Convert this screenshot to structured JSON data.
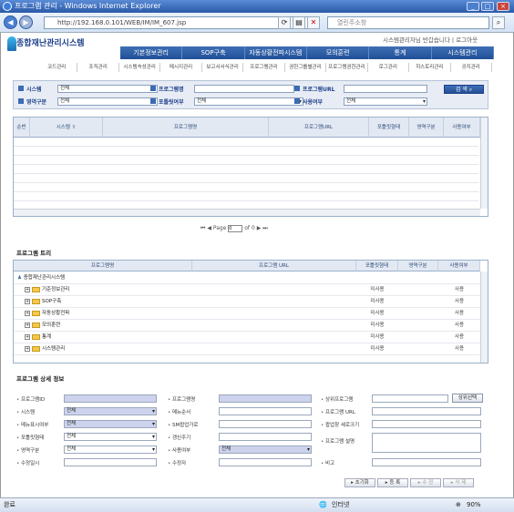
{
  "window": {
    "title": "프로그램 관리 - Windows Internet Explorer",
    "minimize": "_",
    "maximize": "□",
    "close": "×"
  },
  "toolbar": {
    "address": "http://192.168.0.101/WEB/IM/IM_607.jsp",
    "search_placeholder": "열린주소창"
  },
  "header": {
    "logo_text": "종합재난관리시스템",
    "user_info": "시스템관리자님 반갑습니다 | 로그아웃",
    "main_menu": [
      "기본정보관리",
      "SOP구축",
      "자동상황전파시스템",
      "모의훈련",
      "통계",
      "시스템관리"
    ],
    "sub_menu": [
      "코드관리",
      "조직관리",
      "시스템속성관리",
      "메시지관리",
      "보고서서식관리",
      "프로그램관리",
      "권한그룹별관리",
      "프로그램권한관리",
      "로그관리",
      "히스토리관리",
      "공지관리"
    ]
  },
  "search": {
    "system_label": "시스템",
    "system_value": "전체",
    "program_name_label": "프로그램명",
    "program_name_value": "",
    "program_url_label": "프로그램URL",
    "program_url_value": "",
    "area_label": "영역구분",
    "area_value": "전체",
    "portlet_label": "포틀릿여부",
    "portlet_value": "전체",
    "use_label": "사용여부",
    "use_value": "전체",
    "search_button": "검 색"
  },
  "grid": {
    "columns": [
      "순번",
      "시스템 ⇧",
      "프로그램명",
      "프로그램URL",
      "포틀릿형태",
      "영역구분",
      "사용여부"
    ],
    "rows": [],
    "pager": {
      "page_label": "Page",
      "page_value": "0",
      "of_label": "of 0"
    }
  },
  "tree": {
    "title": "프로그램 트리",
    "columns": [
      "프로그램명",
      "프로그램 URL",
      "포틀릿형태",
      "영역구분",
      "사용여부"
    ],
    "root": "종합재난관리시스템",
    "rows": [
      {
        "name": "기준정보관리",
        "portlet": "미사용",
        "use": "사용"
      },
      {
        "name": "SOP구축",
        "portlet": "미사용",
        "use": "사용"
      },
      {
        "name": "자동상황전파",
        "portlet": "미사용",
        "use": "사용"
      },
      {
        "name": "모의훈련",
        "portlet": "미사용",
        "use": "사용"
      },
      {
        "name": "통계",
        "portlet": "미사용",
        "use": "사용"
      },
      {
        "name": "시스템관리",
        "portlet": "미사용",
        "use": "사용"
      }
    ]
  },
  "detail": {
    "title": "프로그램 상세 정보",
    "labels": {
      "program_id": "프로그램ID",
      "program_name": "프로그램명",
      "parent_program": "상위프로그램",
      "system": "시스템",
      "menu_order": "메뉴순서",
      "program_url": "프로그램 URL",
      "menu_show": "메뉴표시여부",
      "sm_page": "SM팝업가로",
      "popup_size": "팝업창 세로크기",
      "portlet_type": "포틀릿형태",
      "refresh": "갱신주기",
      "program_desc": "프로그램 설명",
      "area": "영역구분",
      "use": "사용여부",
      "created": "수정일시",
      "modifier": "수정자",
      "note": "비고"
    },
    "values": {
      "system": "전체",
      "menu_show": "전체",
      "portlet_type": "전체",
      "area": "전체",
      "use": "전체"
    },
    "parent_select_button": "상위선택"
  },
  "actions": {
    "reset": "초기화",
    "register": "등 록",
    "edit": "수 정",
    "delete": "삭 제"
  },
  "statusbar": {
    "left": "완료",
    "zone": "인터넷",
    "zoom": "90%"
  }
}
